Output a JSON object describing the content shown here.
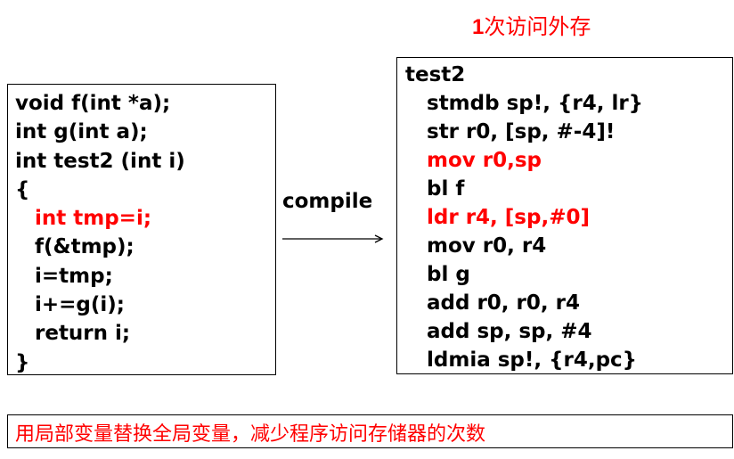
{
  "title": {
    "number": "1",
    "text": "次访问外存"
  },
  "left_code": {
    "lines": [
      {
        "text": "void f(int *a);",
        "color": "#000000",
        "indent": false
      },
      {
        "text": "int g(int a);",
        "color": "#000000",
        "indent": false
      },
      {
        "text": "int test2 (int i)",
        "color": "#000000",
        "indent": false
      },
      {
        "text": "{",
        "color": "#000000",
        "indent": false
      },
      {
        "text": "int tmp=i;",
        "color": "#ff0000",
        "indent": true
      },
      {
        "text": "f(&tmp);",
        "color": "#000000",
        "indent": true
      },
      {
        "text": "i=tmp;",
        "color": "#000000",
        "indent": true
      },
      {
        "text": "i+=g(i);",
        "color": "#000000",
        "indent": true
      },
      {
        "text": "return i;",
        "color": "#000000",
        "indent": true
      },
      {
        "text": "}",
        "color": "#000000",
        "indent": false
      }
    ]
  },
  "compile_label": "compile",
  "right_code": {
    "lines": [
      {
        "text": "test2",
        "color": "#000000",
        "indent": false
      },
      {
        "text": "stmdb sp!, {r4, lr}",
        "color": "#000000",
        "indent": true
      },
      {
        "text": "str r0, [sp, #-4]!",
        "color": "#000000",
        "indent": true
      },
      {
        "text": "mov r0,sp",
        "color": "#ff0000",
        "indent": true
      },
      {
        "text": "bl f",
        "color": "#000000",
        "indent": true
      },
      {
        "text": "ldr r4, [sp,#0]",
        "color": "#ff0000",
        "indent": true
      },
      {
        "text": "mov r0, r4",
        "color": "#000000",
        "indent": true
      },
      {
        "text": "bl g",
        "color": "#000000",
        "indent": true
      },
      {
        "text": "add r0, r0, r4",
        "color": "#000000",
        "indent": true
      },
      {
        "text": "add sp, sp, #4",
        "color": "#000000",
        "indent": true
      },
      {
        "text": "ldmia sp!, {r4,pc}",
        "color": "#000000",
        "indent": true
      }
    ]
  },
  "note": "用局部变量替换全局变量，减少程序访问存储器的次数",
  "colors": {
    "highlight": "#ff0000",
    "text": "#000000",
    "border": "#000000"
  }
}
